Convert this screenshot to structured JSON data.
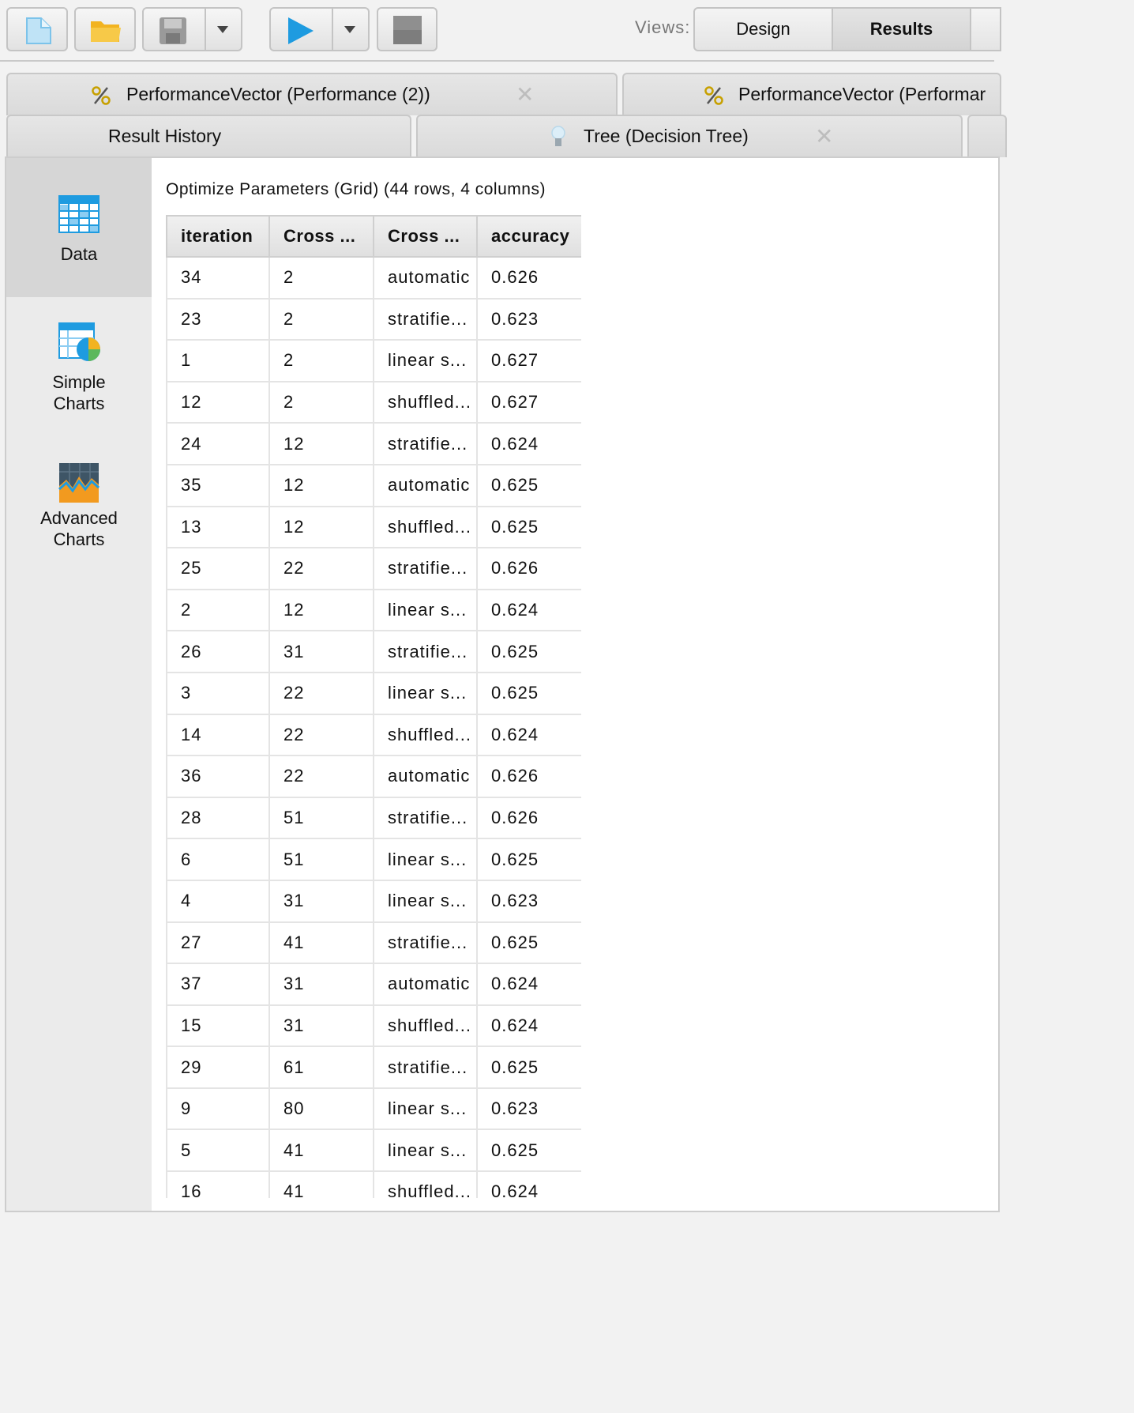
{
  "toolbar": {
    "views_label": "Views:",
    "design_label": "Design",
    "results_label": "Results"
  },
  "tabs_row1": [
    {
      "label": "PerformanceVector (Performance (2))",
      "icon": "percent-icon"
    },
    {
      "label": "PerformanceVector (Performar",
      "icon": "percent-icon"
    }
  ],
  "tabs_row2": [
    {
      "label": "Result History"
    },
    {
      "label": "Tree (Decision Tree)",
      "icon": "lightbulb-icon"
    }
  ],
  "sidebar": {
    "items": [
      {
        "label": "Data",
        "icon": "table-icon"
      },
      {
        "label_line1": "Simple",
        "label_line2": "Charts",
        "icon": "pie-chart-icon"
      },
      {
        "label_line1": "Advanced",
        "label_line2": "Charts",
        "icon": "advanced-chart-icon"
      }
    ]
  },
  "result": {
    "title": "Optimize Parameters (Grid) (44 rows, 4 columns)",
    "columns": [
      "iteration",
      "Cross ...",
      "Cross ...",
      "accuracy"
    ],
    "rows": [
      [
        "34",
        "2",
        "automatic",
        "0.626"
      ],
      [
        "23",
        "2",
        "stratifie...",
        "0.623"
      ],
      [
        "1",
        "2",
        "linear s...",
        "0.627"
      ],
      [
        "12",
        "2",
        "shuffled...",
        "0.627"
      ],
      [
        "24",
        "12",
        "stratifie...",
        "0.624"
      ],
      [
        "35",
        "12",
        "automatic",
        "0.625"
      ],
      [
        "13",
        "12",
        "shuffled...",
        "0.625"
      ],
      [
        "25",
        "22",
        "stratifie...",
        "0.626"
      ],
      [
        "2",
        "12",
        "linear s...",
        "0.624"
      ],
      [
        "26",
        "31",
        "stratifie...",
        "0.625"
      ],
      [
        "3",
        "22",
        "linear s...",
        "0.625"
      ],
      [
        "14",
        "22",
        "shuffled...",
        "0.624"
      ],
      [
        "36",
        "22",
        "automatic",
        "0.626"
      ],
      [
        "28",
        "51",
        "stratifie...",
        "0.626"
      ],
      [
        "6",
        "51",
        "linear s...",
        "0.625"
      ],
      [
        "4",
        "31",
        "linear s...",
        "0.623"
      ],
      [
        "27",
        "41",
        "stratifie...",
        "0.625"
      ],
      [
        "37",
        "31",
        "automatic",
        "0.624"
      ],
      [
        "15",
        "31",
        "shuffled...",
        "0.624"
      ],
      [
        "29",
        "61",
        "stratifie...",
        "0.625"
      ],
      [
        "9",
        "80",
        "linear s...",
        "0.623"
      ],
      [
        "5",
        "41",
        "linear s...",
        "0.625"
      ],
      [
        "16",
        "41",
        "shuffled...",
        "0.624"
      ]
    ]
  }
}
